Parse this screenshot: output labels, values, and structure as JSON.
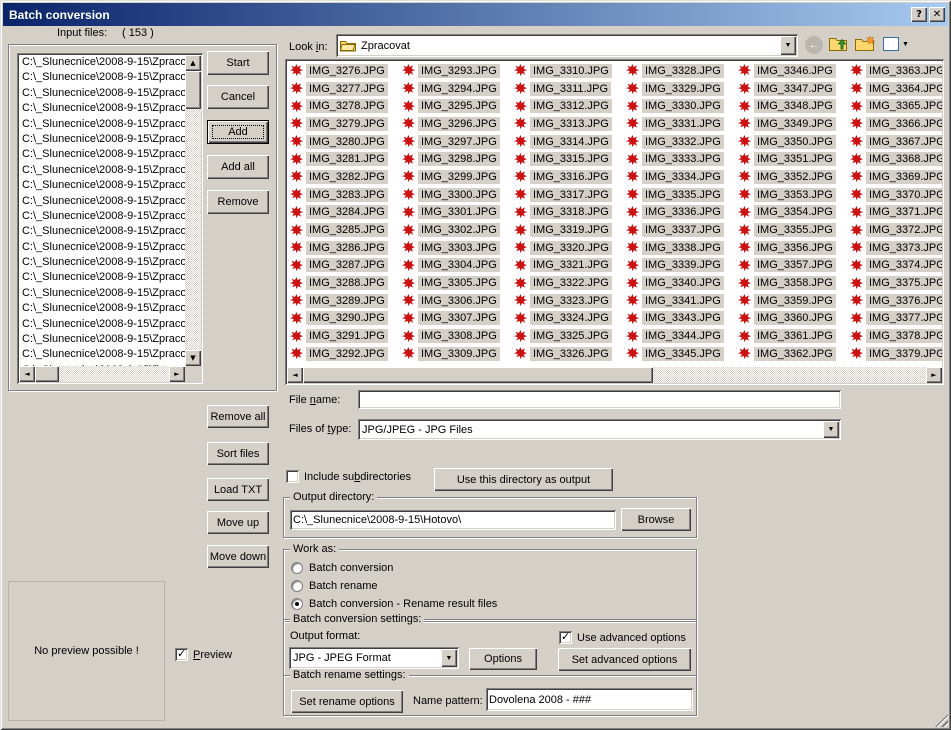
{
  "window": {
    "title": "Batch conversion",
    "help_glyph": "?",
    "close_glyph": "✕"
  },
  "input_files": {
    "label": "Input files:",
    "count": "( 153 )",
    "visible_row_text": "C:\\_Slunecnice\\2008-9-15\\Zpraco",
    "visible_row_count": 21
  },
  "actions": {
    "start": "Start",
    "cancel": "Cancel",
    "add": "Add",
    "add_all": "Add all",
    "remove": "Remove",
    "remove_all": "Remove all",
    "sort_files": "Sort files",
    "load_txt": "Load TXT",
    "move_up": "Move up",
    "move_down": "Move down"
  },
  "browser": {
    "look_in_label": "Look &in:",
    "look_in_value": "Zpracovat",
    "toolbar_icons": [
      "back",
      "up-one-level",
      "create-new-folder",
      "view-menu"
    ],
    "columns": [
      [
        "IMG_3276.JPG",
        "IMG_3277.JPG",
        "IMG_3278.JPG",
        "IMG_3279.JPG",
        "IMG_3280.JPG",
        "IMG_3281.JPG",
        "IMG_3282.JPG",
        "IMG_3283.JPG",
        "IMG_3284.JPG",
        "IMG_3285.JPG",
        "IMG_3286.JPG",
        "IMG_3287.JPG",
        "IMG_3288.JPG",
        "IMG_3289.JPG",
        "IMG_3290.JPG",
        "IMG_3291.JPG",
        "IMG_3292.JPG"
      ],
      [
        "IMG_3293.JPG",
        "IMG_3294.JPG",
        "IMG_3295.JPG",
        "IMG_3296.JPG",
        "IMG_3297.JPG",
        "IMG_3298.JPG",
        "IMG_3299.JPG",
        "IMG_3300.JPG",
        "IMG_3301.JPG",
        "IMG_3302.JPG",
        "IMG_3303.JPG",
        "IMG_3304.JPG",
        "IMG_3305.JPG",
        "IMG_3306.JPG",
        "IMG_3307.JPG",
        "IMG_3308.JPG",
        "IMG_3309.JPG"
      ],
      [
        "IMG_3310.JPG",
        "IMG_3311.JPG",
        "IMG_3312.JPG",
        "IMG_3313.JPG",
        "IMG_3314.JPG",
        "IMG_3315.JPG",
        "IMG_3316.JPG",
        "IMG_3317.JPG",
        "IMG_3318.JPG",
        "IMG_3319.JPG",
        "IMG_3320.JPG",
        "IMG_3321.JPG",
        "IMG_3322.JPG",
        "IMG_3323.JPG",
        "IMG_3324.JPG",
        "IMG_3325.JPG",
        "IMG_3326.JPG"
      ],
      [
        "IMG_3328.JPG",
        "IMG_3329.JPG",
        "IMG_3330.JPG",
        "IMG_3331.JPG",
        "IMG_3332.JPG",
        "IMG_3333.JPG",
        "IMG_3334.JPG",
        "IMG_3335.JPG",
        "IMG_3336.JPG",
        "IMG_3337.JPG",
        "IMG_3338.JPG",
        "IMG_3339.JPG",
        "IMG_3340.JPG",
        "IMG_3341.JPG",
        "IMG_3343.JPG",
        "IMG_3344.JPG",
        "IMG_3345.JPG"
      ],
      [
        "IMG_3346.JPG",
        "IMG_3347.JPG",
        "IMG_3348.JPG",
        "IMG_3349.JPG",
        "IMG_3350.JPG",
        "IMG_3351.JPG",
        "IMG_3352.JPG",
        "IMG_3353.JPG",
        "IMG_3354.JPG",
        "IMG_3355.JPG",
        "IMG_3356.JPG",
        "IMG_3357.JPG",
        "IMG_3358.JPG",
        "IMG_3359.JPG",
        "IMG_3360.JPG",
        "IMG_3361.JPG",
        "IMG_3362.JPG"
      ],
      [
        "IMG_3363.JPG",
        "IMG_3364.JPG",
        "IMG_3365.JPG",
        "IMG_3366.JPG",
        "IMG_3367.JPG",
        "IMG_3368.JPG",
        "IMG_3369.JPG",
        "IMG_3370.JPG",
        "IMG_3371.JPG",
        "IMG_3372.JPG",
        "IMG_3373.JPG",
        "IMG_3374.JPG",
        "IMG_3375.JPG",
        "IMG_3376.JPG",
        "IMG_3377.JPG",
        "IMG_3378.JPG",
        "IMG_3379.JPG"
      ]
    ]
  },
  "file_name": {
    "label": "File &name:",
    "value": ""
  },
  "files_of_type": {
    "label": "Files of &type:",
    "value": "JPG/JPEG - JPG Files"
  },
  "include_subdirectories": {
    "label": "Include su&bdirectories",
    "checked": false
  },
  "use_directory_button": "Use this directory as output",
  "output_directory": {
    "label": "Output directory:",
    "value": "C:\\_Slunecnice\\2008-9-15\\Hotovo\\",
    "browse_button": "Browse"
  },
  "work_as": {
    "label": "Work as:",
    "options": [
      {
        "label": "Batch conversion",
        "selected": false
      },
      {
        "label": "Batch rename",
        "selected": false
      },
      {
        "label": "Batch conversion - Rename result files",
        "selected": true
      }
    ]
  },
  "batch_conversion_settings": {
    "label": "Batch conversion settings:",
    "output_format_label": "Output format:",
    "output_format_value": "JPG - JPEG Format",
    "options_button": "Options",
    "use_advanced_options": {
      "label": "Use advanced options",
      "checked": true
    },
    "set_advanced_button": "Set advanced options"
  },
  "batch_rename_settings": {
    "label": "Batch rename settings:",
    "set_rename_button": "Set rename options",
    "name_pattern_label": "Name pattern:",
    "name_pattern_value": "Dovolena 2008 - ###"
  },
  "preview": {
    "message": "No preview possible !",
    "label": "&Preview",
    "checked": true
  },
  "colors": {
    "face": "#d4d0c8",
    "title_gradient_left": "#0a246a",
    "title_gradient_right": "#a6caf0",
    "file_icon_red": "#d01010",
    "selection_gray": "#d4d0c8"
  }
}
